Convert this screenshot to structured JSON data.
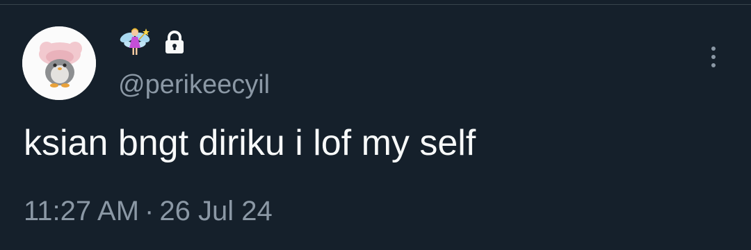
{
  "tweet": {
    "display_name": {
      "icons": [
        "fairy-emoji-icon",
        "lock-icon"
      ]
    },
    "handle": "@perikeecyil",
    "text": "ksian bngt diriku i lof my self",
    "time": "11:27 AM",
    "separator": "·",
    "date": "26 Jul 24",
    "more_icon": "vertical-dots-icon"
  },
  "theme": {
    "background": "#15202b",
    "primary_text": "#f7f9f9",
    "secondary_text": "#8b98a5",
    "divider": "#38444d"
  }
}
